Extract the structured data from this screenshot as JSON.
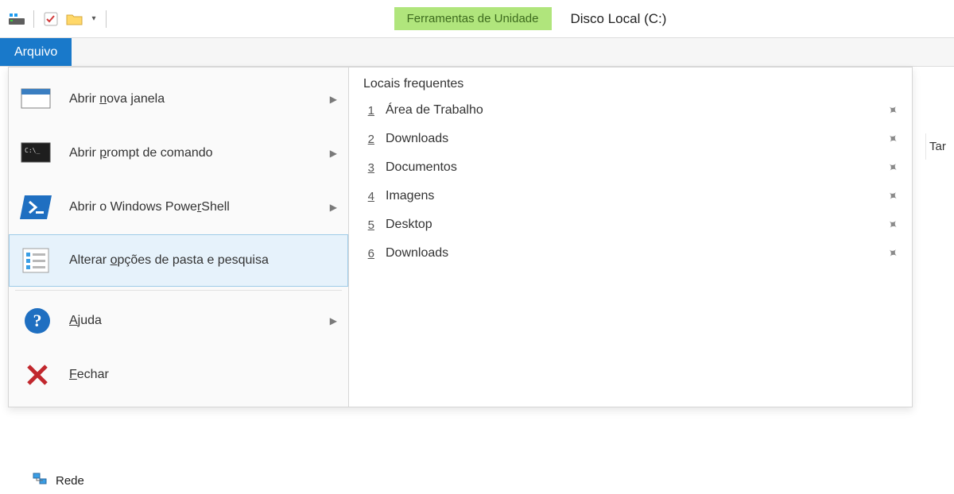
{
  "title_bar": {
    "context_tab": "Ferramentas de Unidade",
    "window_title": "Disco Local (C:)"
  },
  "ribbon": {
    "active_tab": "Arquivo"
  },
  "file_menu": {
    "items": [
      {
        "label_pre": "Abrir ",
        "access": "n",
        "label_post": "ova janela",
        "has_arrow": true,
        "icon": "window"
      },
      {
        "label_pre": "Abrir ",
        "access": "p",
        "label_post": "rompt de comando",
        "has_arrow": true,
        "icon": "cmd"
      },
      {
        "label_pre": "Abrir o Windows Powe",
        "access": "r",
        "label_post": "Shell",
        "has_arrow": true,
        "icon": "ps"
      },
      {
        "label_pre": "Alterar ",
        "access": "o",
        "label_post": "pções de pasta e pesquisa",
        "has_arrow": false,
        "icon": "opts",
        "hovered": true
      },
      {
        "label_pre": "",
        "access": "A",
        "label_post": "juda",
        "has_arrow": true,
        "icon": "help"
      },
      {
        "label_pre": "",
        "access": "F",
        "label_post": "echar",
        "has_arrow": false,
        "icon": "close"
      }
    ],
    "frequent_header": "Locais frequentes",
    "frequent": [
      {
        "n": "1",
        "label": "Área de Trabalho"
      },
      {
        "n": "2",
        "label": "Downloads"
      },
      {
        "n": "3",
        "label": "Documentos"
      },
      {
        "n": "4",
        "label": "Imagens"
      },
      {
        "n": "5",
        "label": "Desktop"
      },
      {
        "n": "6",
        "label": "Downloads"
      }
    ]
  },
  "body": {
    "right_text": "Tar"
  },
  "tree": {
    "network_label": "Rede"
  }
}
